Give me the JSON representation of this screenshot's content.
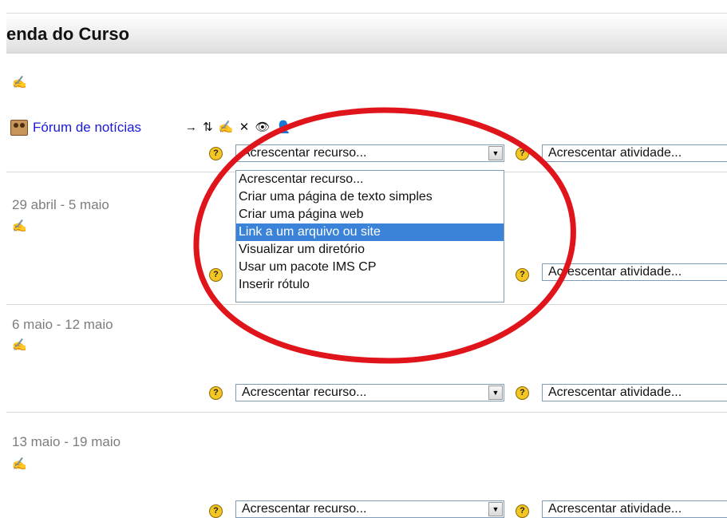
{
  "header": {
    "title": "enda do Curso"
  },
  "forum": {
    "link": "Fórum de notícias",
    "tools": [
      "→",
      "⇅",
      "✍",
      "✕",
      "👁",
      "👤"
    ]
  },
  "add_resource": {
    "label": "Acrescentar recurso...",
    "options": [
      "Acrescentar recurso...",
      "Criar uma página de texto simples",
      "Criar uma página web",
      "Link a um arquivo ou site",
      "Visualizar um diretório",
      "Usar um pacote IMS CP",
      "Inserir rótulo"
    ],
    "highlighted_index": 3
  },
  "add_activity": {
    "label": "Acrescentar atividade..."
  },
  "weeks": [
    {
      "dates": "29 abril - 5 maio"
    },
    {
      "dates": "6 maio - 12 maio"
    },
    {
      "dates": "13 maio - 19 maio"
    }
  ],
  "icons": {
    "edit": "✍",
    "help": "?",
    "dropdown_arrow": "▼"
  },
  "colors": {
    "highlight": "#3b83d8",
    "link": "#1a1ad6",
    "annotation_ring": "#e0141b",
    "help_icon": "#f3c623"
  }
}
